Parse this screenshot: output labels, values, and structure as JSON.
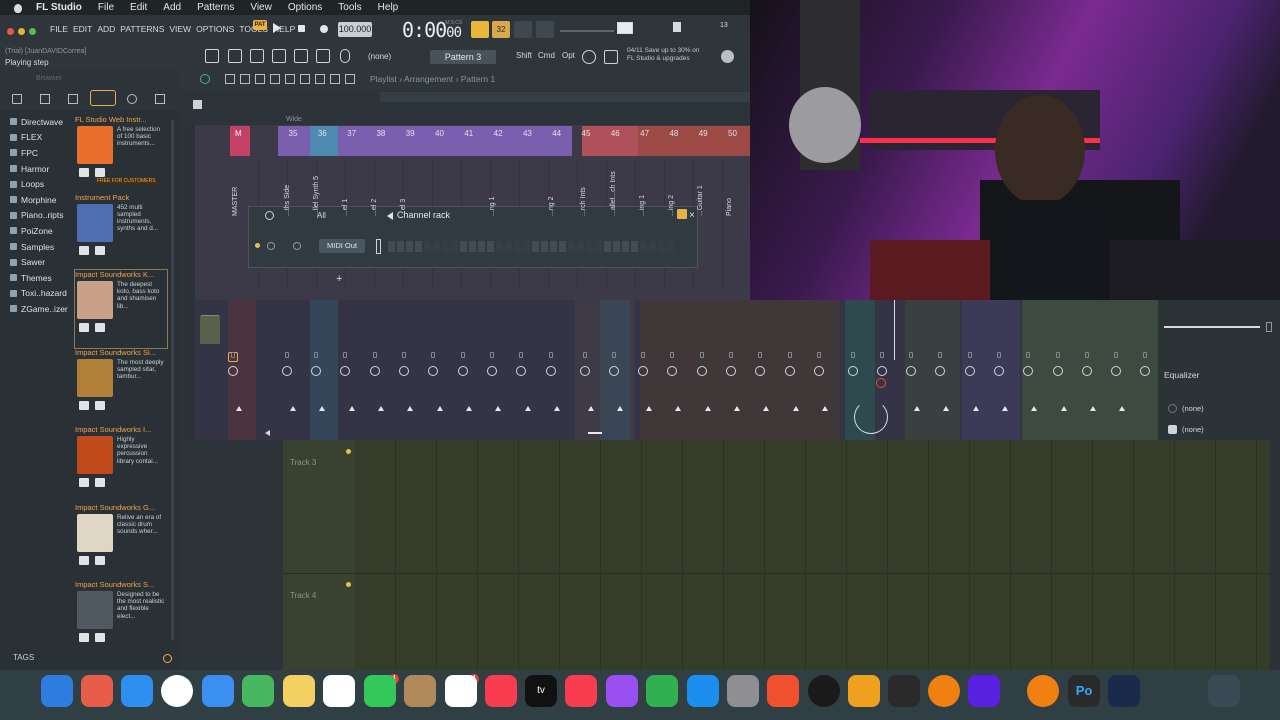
{
  "macos_menu": {
    "app": "FL Studio",
    "items": [
      "File",
      "Edit",
      "Add",
      "Patterns",
      "View",
      "Options",
      "Tools",
      "Help"
    ]
  },
  "fl_toolbar": {
    "menu": [
      "FILE",
      "EDIT",
      "ADD",
      "PATTERNS",
      "VIEW",
      "OPTIONS",
      "TOOLS",
      "HELP"
    ],
    "pat_label": "PAT",
    "trial_user": "(Trial) [JuanDAVIDCorrea]",
    "status": "Playing step",
    "tempo": "100.000",
    "time": "0:00",
    "time_suffix": "00",
    "time_sub": "M:S:CS",
    "metronome_label": "32",
    "pattern": "Pattern 3",
    "none_select": "(none)",
    "keys": [
      "Shift",
      "Cmd",
      "Opt"
    ],
    "promo_date": "04/11",
    "promo_line1": "Save up to 30% on",
    "promo_line2": "FL Studio & upgrades",
    "cpu_nums": "13"
  },
  "browser": {
    "label": "Browser",
    "folders": [
      "Directwave",
      "FLEX",
      "FPC",
      "Harmor",
      "Loops",
      "Morphine",
      "Piano..ripts",
      "PoiZone",
      "Samples",
      "Sawer",
      "Themes",
      "Toxi..hazard",
      "ZGame..izer"
    ],
    "packs": [
      {
        "title": "FL Studio Web Instr...",
        "desc": "A free selection of 100 basic instruments...",
        "badge": "FREE FOR CUSTOMERS",
        "color": "#e8702a"
      },
      {
        "title": "Instrument Pack",
        "desc": "452 multi sampled instruments, synths and d...",
        "badge": "",
        "color": "#4f6fb0"
      },
      {
        "title": "Impact Soundworks K...",
        "desc": "The deepest koto, bass koto and shamisen lib...",
        "badge": "",
        "color": "#c8a088"
      },
      {
        "title": "Impact Soundworks Si...",
        "desc": "The most deeply sampled sitar, tambur...",
        "badge": "",
        "color": "#b08038"
      },
      {
        "title": "Impact Soundworks I...",
        "desc": "Highly expressive percussion library contai...",
        "badge": "",
        "color": "#c04a1a"
      },
      {
        "title": "Impact Soundworks G...",
        "desc": "Relive an era of classic drum sounds wher...",
        "badge": "",
        "color": "#e0d6c4"
      },
      {
        "title": "Impact Soundworks S...",
        "desc": "Designed to be the most realistic and flexible elect...",
        "badge": "",
        "color": "#505860"
      }
    ],
    "tags_label": "TAGS"
  },
  "playlist": {
    "crumb_root": "Playlist",
    "crumb_arr": "Arrangement",
    "crumb_pat": "Pattern 1",
    "wide": "Wide",
    "tracks": [
      "Track 3",
      "Track 4"
    ]
  },
  "mixer": {
    "master_letter": "M",
    "numbers": [
      "35",
      "36",
      "37",
      "38",
      "39",
      "40",
      "41",
      "42",
      "43",
      "44",
      "45",
      "46",
      "47",
      "48",
      "49",
      "50"
    ],
    "names": [
      "MASTER",
      "...ths Side",
      "...llel Synth 5",
      "...el 1",
      "...el 2",
      "...el 3",
      "...ng 1",
      "...ng 2",
      "...rch Ints",
      "...allel...ch Ints",
      "...ing 1",
      "...ing 2",
      "...Guitar 1",
      "Piano"
    ]
  },
  "channel_rack": {
    "title": "Channel rack",
    "filter": "All",
    "channel": "MIDI Out"
  },
  "equalizer": {
    "label": "Equalizer",
    "slots": [
      "(none)",
      "(none)"
    ]
  },
  "dock": {
    "apps": [
      "finder-icon",
      "launchpad-icon",
      "safari-icon",
      "chrome-icon",
      "mail-icon",
      "maps-icon",
      "notes-icon",
      "freeform-icon",
      "facetime-icon",
      "contacts-icon",
      "reminders-icon",
      "music-icon",
      "appletv-icon",
      "news-icon",
      "podcasts-icon",
      "numbers-icon",
      "appstore-icon",
      "settings-icon",
      "pen-icon",
      "apogee-icon",
      "mixer-icon",
      "flstudio-icon",
      "arturia-icon",
      "flstudio2-icon",
      "obs-icon",
      "photoshop-icon",
      "apogee2-icon",
      "trash-icon"
    ],
    "badge_facetime": "4",
    "badge_reminders": "4",
    "appletv_label": "tv",
    "photoshop_label": "Po"
  }
}
